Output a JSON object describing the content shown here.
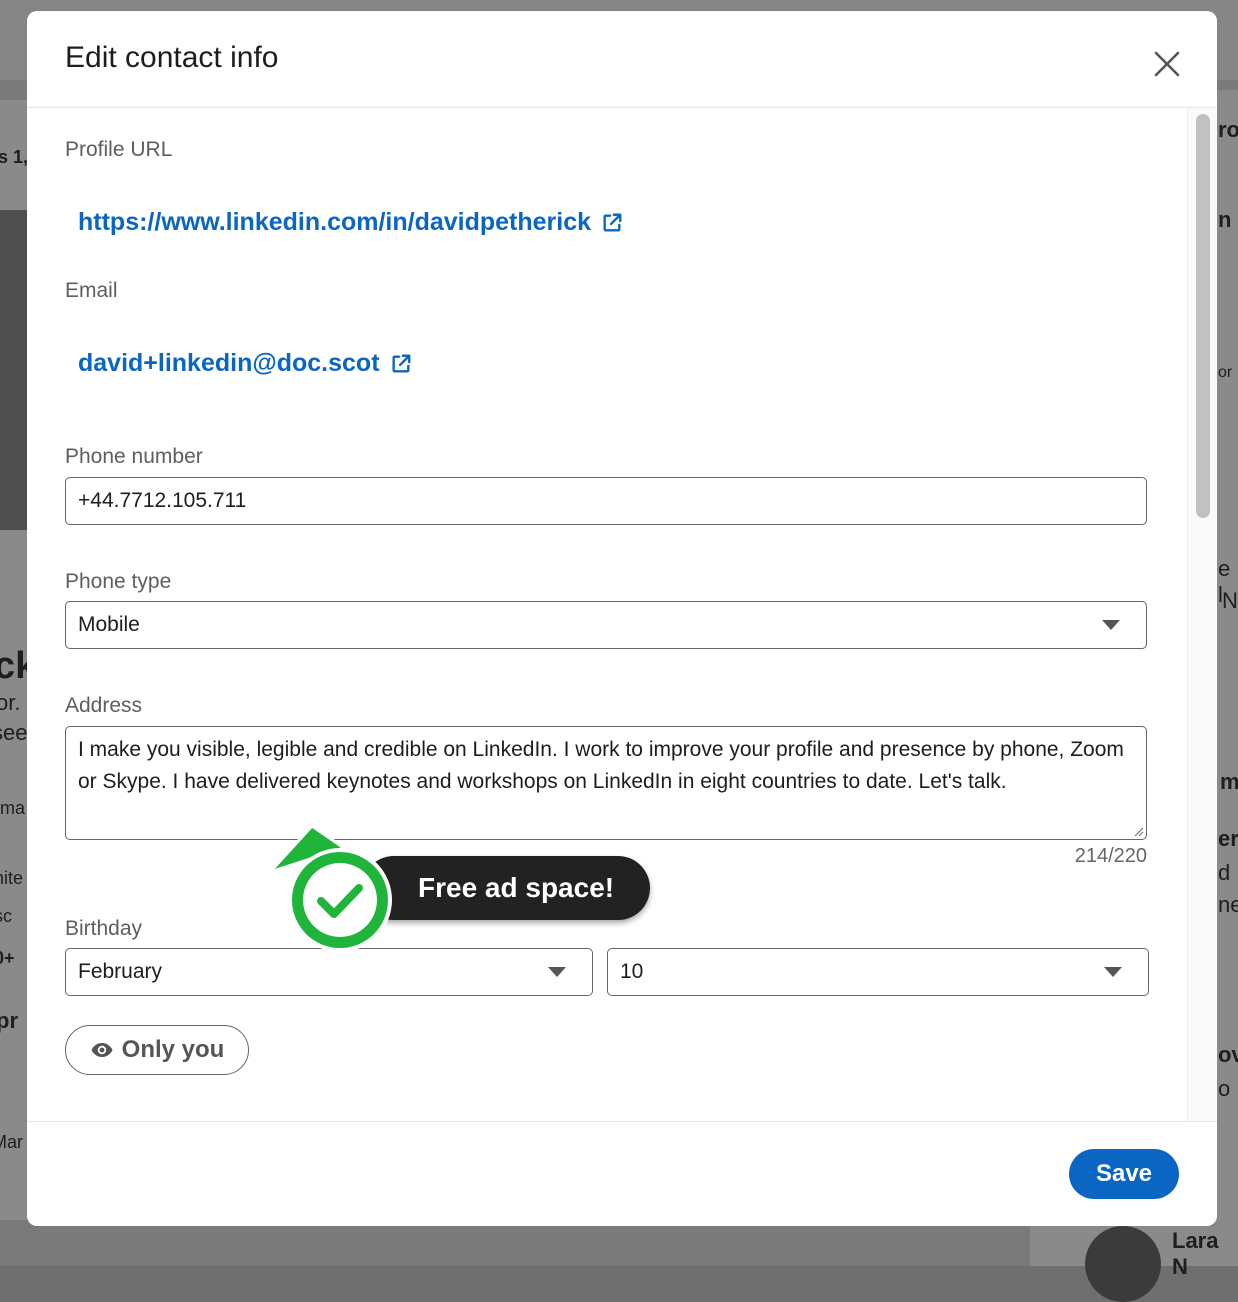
{
  "background": {
    "fragments": [
      {
        "text": "s 1,",
        "x": 0
      },
      {
        "text": "ck",
        "x": 0
      },
      {
        "text": "or.",
        "x": 0
      },
      {
        "text": "see",
        "x": 0
      },
      {
        "text": "rma",
        "x": 0
      },
      {
        "text": "nite",
        "x": 0
      },
      {
        "text": "sc",
        "x": 0
      },
      {
        "text": "0+",
        "x": 0
      },
      {
        "text": "pr",
        "x": 0
      },
      {
        "text": "Mar",
        "x": 0
      },
      {
        "text": "ro",
        "x": 0
      },
      {
        "text": "n",
        "x": 0
      },
      {
        "text": "or",
        "x": 0
      },
      {
        "text": "e l",
        "x": 0
      },
      {
        "text": "N",
        "x": 0
      },
      {
        "text": "m",
        "x": 0
      },
      {
        "text": "er",
        "x": 0
      },
      {
        "text": "d",
        "x": 0
      },
      {
        "text": "ne",
        "x": 0
      },
      {
        "text": "ov",
        "x": 0
      },
      {
        "text": "o",
        "x": 0
      },
      {
        "text": "Lara N",
        "x": 0
      }
    ]
  },
  "modal": {
    "title": "Edit contact info",
    "profile_url": {
      "label": "Profile URL",
      "value": "https://www.linkedin.com/in/davidpetherick"
    },
    "email": {
      "label": "Email",
      "value": "david+linkedin@doc.scot"
    },
    "phone_number": {
      "label": "Phone number",
      "value": "+44.7712.105.711"
    },
    "phone_type": {
      "label": "Phone type",
      "value": "Mobile"
    },
    "address": {
      "label": "Address",
      "value": "I make you visible, legible and credible on LinkedIn. I work to improve your profile and presence by phone, Zoom or Skype. I have delivered keynotes and workshops on LinkedIn in eight countries to date. Let's talk.",
      "counter": "214/220"
    },
    "birthday": {
      "label": "Birthday",
      "month": "February",
      "day": "10"
    },
    "visibility": {
      "label": "Only you",
      "icon": "eye-icon"
    },
    "save_label": "Save"
  },
  "ad": {
    "text": "Free ad space!",
    "accent": "#1fb53a"
  }
}
